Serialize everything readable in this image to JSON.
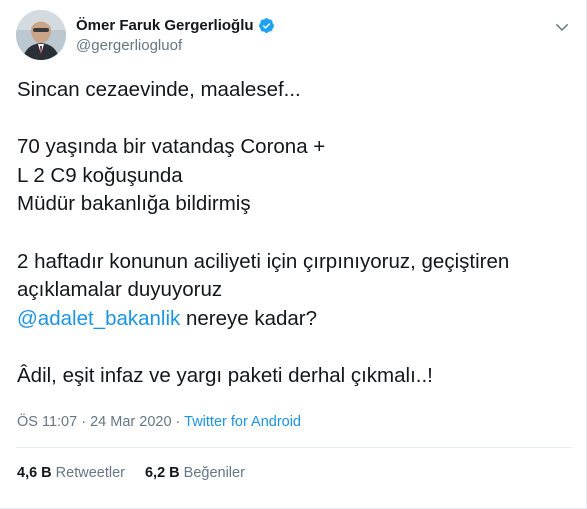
{
  "author": {
    "display_name": "Ömer Faruk Gergerlioğlu",
    "handle": "@gergerliogluof",
    "verified": true
  },
  "tweet": {
    "lines": [
      "Sincan cezaevinde, maalesef...",
      "",
      "70 yaşında bir vatandaş Corona +",
      "L 2 C9 koğuşunda",
      "Müdür bakanlığa bildirmiş",
      "",
      "2 haftadır konunun aciliyeti için çırpınıyoruz, geçiştiren",
      "açıklamalar duyuyoruz"
    ],
    "mention": "@adalet_bakanlik",
    "mention_rest": " nereye kadar?",
    "closing": "Âdil, eşit infaz ve yargı paketi derhal çıkmalı..!"
  },
  "meta": {
    "time": "ÖS 11:07",
    "separator1": " · ",
    "date": "24 Mar 2020",
    "separator2": " · ",
    "source": "Twitter for Android"
  },
  "stats": {
    "retweets_count": "4,6 B",
    "retweets_label": "Retweetler",
    "likes_count": "6,2 B",
    "likes_label": "Beğeniler"
  },
  "colors": {
    "link": "#1b95e0",
    "text": "#14171a",
    "secondary": "#657786",
    "verified": "#1da1f2"
  },
  "icons": {
    "verified": "verified-badge-icon",
    "more": "chevron-down-icon"
  }
}
